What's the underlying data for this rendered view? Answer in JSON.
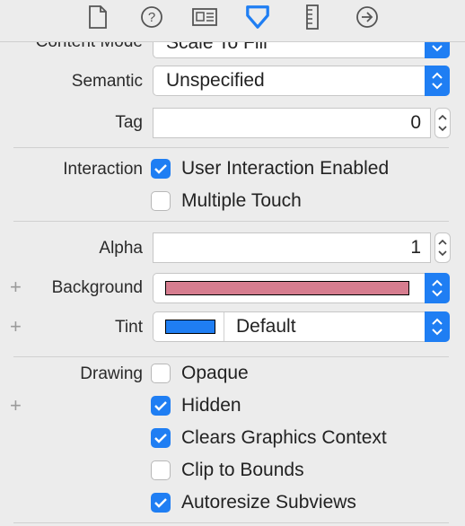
{
  "toolbar": {
    "tabs": [
      {
        "icon": "file-inspector-icon"
      },
      {
        "icon": "quick-help-icon"
      },
      {
        "icon": "identity-inspector-icon"
      },
      {
        "icon": "attributes-inspector-icon"
      },
      {
        "icon": "size-inspector-icon"
      },
      {
        "icon": "connections-inspector-icon"
      }
    ],
    "accent": "#1f7ef3"
  },
  "content_mode": {
    "label": "Content Mode",
    "value": "Scale To Fill"
  },
  "semantic": {
    "label": "Semantic",
    "value": "Unspecified"
  },
  "tag": {
    "label": "Tag",
    "value": "0"
  },
  "interaction": {
    "label": "Interaction",
    "options": [
      {
        "label": "User Interaction Enabled",
        "checked": true
      },
      {
        "label": "Multiple Touch",
        "checked": false
      }
    ]
  },
  "alpha": {
    "label": "Alpha",
    "value": "1"
  },
  "background": {
    "label": "Background",
    "color": "#d67d8f"
  },
  "tint": {
    "label": "Tint",
    "color": "#1f7ef3",
    "value": "Default"
  },
  "drawing": {
    "label": "Drawing",
    "options": [
      {
        "label": "Opaque",
        "checked": false
      },
      {
        "label": "Hidden",
        "checked": true
      },
      {
        "label": "Clears Graphics Context",
        "checked": true
      },
      {
        "label": "Clip to Bounds",
        "checked": false
      },
      {
        "label": "Autoresize Subviews",
        "checked": true
      }
    ]
  },
  "plus_glyph": "+"
}
